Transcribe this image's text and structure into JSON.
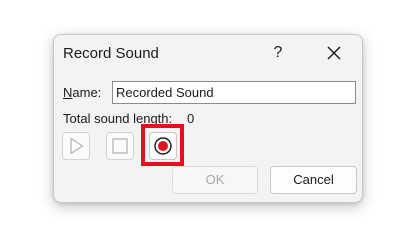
{
  "dialog": {
    "title": "Record Sound",
    "help_label": "?",
    "close_icon": "close-icon"
  },
  "name": {
    "label_underlined": "N",
    "label_rest": "ame:",
    "value": "Recorded Sound"
  },
  "length": {
    "label": "Total sound length:",
    "value": "0"
  },
  "controls": {
    "play_icon": "play-icon",
    "stop_icon": "stop-icon",
    "record_icon": "record-icon",
    "record_color": "#e0121f",
    "highlight_color": "#e0121f"
  },
  "buttons": {
    "ok_label": "OK",
    "cancel_label": "Cancel"
  }
}
